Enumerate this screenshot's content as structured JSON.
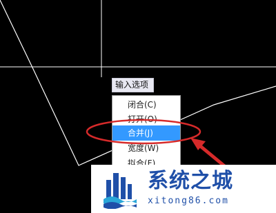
{
  "prompt": {
    "label": "输入选项"
  },
  "context_menu": {
    "items": [
      {
        "label": "闭合(C)"
      },
      {
        "label": "打开(O)"
      },
      {
        "label": "合并(J)"
      },
      {
        "label": "宽度(W)"
      },
      {
        "label": "拟合(F)"
      }
    ],
    "selected_index": 2
  },
  "watermark": {
    "brand": "系统之城",
    "url": "xitong86.com"
  },
  "colors": {
    "canvas_background": "#000000",
    "crosshair": "#ffffff",
    "selection": "#3399ff",
    "highlight_ellipse": "#d62a2a",
    "brand": "#1f4fa8"
  }
}
